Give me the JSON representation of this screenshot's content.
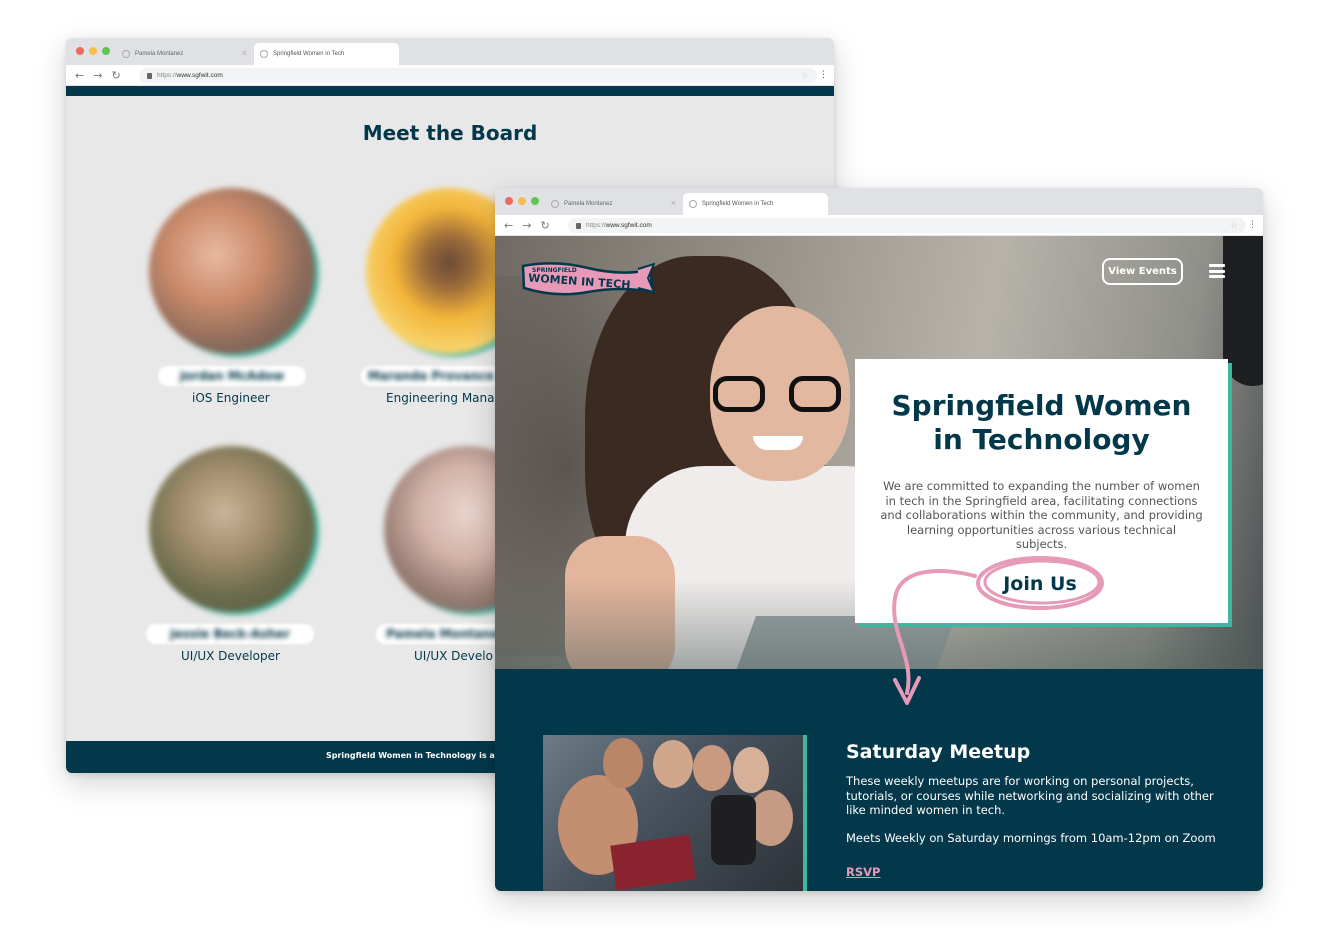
{
  "back_browser": {
    "tabs": [
      {
        "label": "Pamela Montanez"
      },
      {
        "label": "Springfield Women in Tech"
      }
    ],
    "url_protocol": "https://",
    "url_host": "www.sgfwit.com"
  },
  "board": {
    "title": "Meet the Board",
    "members": [
      {
        "name": "Jordan McAdow",
        "role": "iOS Engineer"
      },
      {
        "name": "Maranda Provance",
        "role": "Engineering Mana"
      },
      {
        "name": "Jessie Beck-Asher",
        "role": "UI/UX Developer"
      },
      {
        "name": "Pamela Montanez",
        "role": "UI/UX Develo"
      }
    ],
    "footer": "Springfield Women in Technology is a"
  },
  "front_browser": {
    "tabs": [
      {
        "label": "Pamela Montanez"
      },
      {
        "label": "Springfield Women in Tech"
      }
    ],
    "url_protocol": "https://",
    "url_host": "www.sgfwit.com"
  },
  "site": {
    "logo_top": "SPRINGFIELD",
    "logo_main": "WOMEN IN TECH",
    "nav_button": "View Events",
    "hero_title_line1": "Springfield Women",
    "hero_title_line2": "in Technology",
    "hero_text": "We are committed to expanding the number of women in tech in the Springfield area, facilitating connections and collaborations within the community, and providing learning opportunities across various technical subjects.",
    "cta": "Join Us"
  },
  "event": {
    "title": "Saturday Meetup",
    "description": "These weekly meetups are for working on personal projects, tutorials, or courses while networking and socializing with other like minded women in tech.",
    "schedule": "Meets Weekly on Saturday mornings from 10am-12pm on Zoom",
    "rsvp": "RSVP"
  },
  "colors": {
    "brand_dark": "#03384a",
    "accent_teal": "#3fb6a0",
    "accent_pink": "#e79ab8"
  },
  "icons": [
    "back-arrow-icon",
    "forward-arrow-icon",
    "reload-icon",
    "lock-icon",
    "star-icon",
    "more-icon",
    "globe-icon",
    "close-icon",
    "menu-icon"
  ]
}
